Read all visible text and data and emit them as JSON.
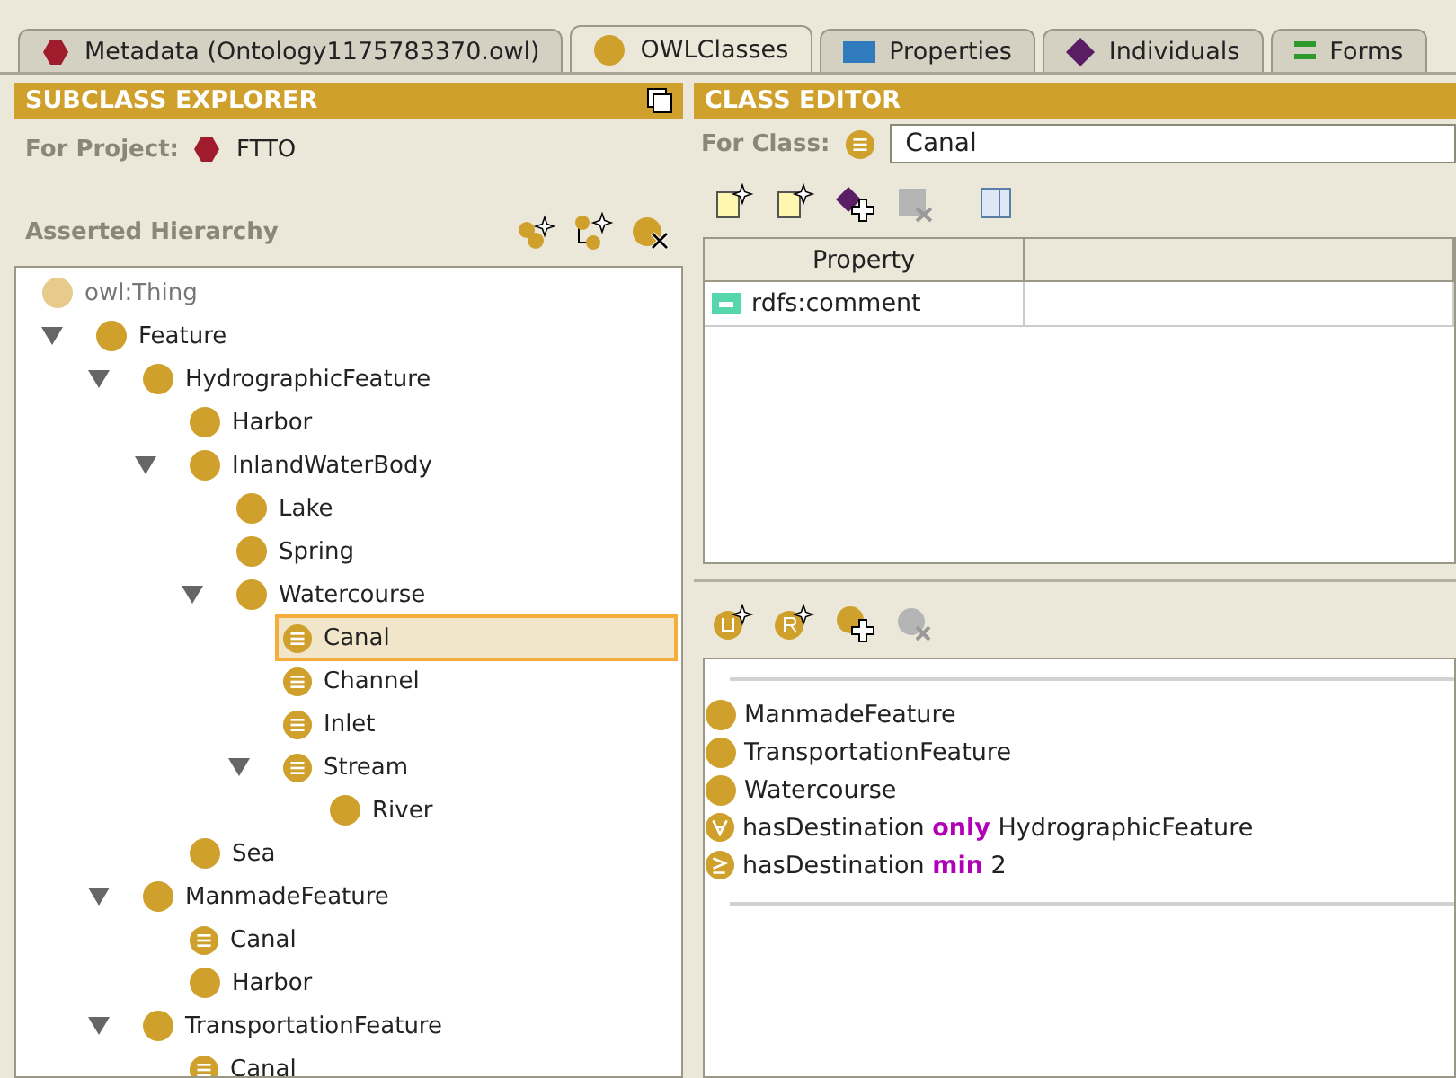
{
  "tabs": [
    {
      "label": "Metadata (Ontology1175783370.owl)",
      "kind": "metadata",
      "selected": false
    },
    {
      "label": "OWLClasses",
      "kind": "classes",
      "selected": true
    },
    {
      "label": "Properties",
      "kind": "properties",
      "selected": false
    },
    {
      "label": "Individuals",
      "kind": "individuals",
      "selected": false
    },
    {
      "label": "Forms",
      "kind": "forms",
      "selected": false
    }
  ],
  "subclass_explorer": {
    "title": "SUBCLASS EXPLORER",
    "project_label": "For Project:",
    "project_name": "FTTO",
    "hierarchy_label": "Asserted Hierarchy",
    "tree": [
      {
        "label": "owl:Thing",
        "kind": "root",
        "selected": false,
        "children": [
          {
            "label": "Feature",
            "kind": "primitive",
            "expanded": true,
            "selected": false,
            "children": [
              {
                "label": "HydrographicFeature",
                "kind": "primitive",
                "expanded": true,
                "selected": false,
                "children": [
                  {
                    "label": "Harbor",
                    "kind": "primitive",
                    "expanded": false,
                    "selected": false
                  },
                  {
                    "label": "InlandWaterBody",
                    "kind": "primitive",
                    "expanded": true,
                    "selected": false,
                    "children": [
                      {
                        "label": "Lake",
                        "kind": "primitive",
                        "expanded": false,
                        "selected": false
                      },
                      {
                        "label": "Spring",
                        "kind": "primitive",
                        "expanded": false,
                        "selected": false
                      },
                      {
                        "label": "Watercourse",
                        "kind": "primitive",
                        "expanded": true,
                        "selected": false,
                        "children": [
                          {
                            "label": "Canal",
                            "kind": "defined",
                            "expanded": false,
                            "selected": true
                          },
                          {
                            "label": "Channel",
                            "kind": "defined",
                            "expanded": false,
                            "selected": false
                          },
                          {
                            "label": "Inlet",
                            "kind": "defined",
                            "expanded": false,
                            "selected": false
                          },
                          {
                            "label": "Stream",
                            "kind": "defined",
                            "expanded": true,
                            "selected": false,
                            "children": [
                              {
                                "label": "River",
                                "kind": "primitive",
                                "expanded": false,
                                "selected": false
                              }
                            ]
                          }
                        ]
                      }
                    ]
                  },
                  {
                    "label": "Sea",
                    "kind": "primitive",
                    "expanded": false,
                    "selected": false
                  }
                ]
              },
              {
                "label": "ManmadeFeature",
                "kind": "primitive",
                "expanded": true,
                "selected": false,
                "children": [
                  {
                    "label": "Canal",
                    "kind": "defined",
                    "expanded": false,
                    "selected": false
                  },
                  {
                    "label": "Harbor",
                    "kind": "primitive",
                    "expanded": false,
                    "selected": false
                  }
                ]
              },
              {
                "label": "TransportationFeature",
                "kind": "primitive",
                "expanded": true,
                "selected": false,
                "children": [
                  {
                    "label": "Canal",
                    "kind": "defined",
                    "expanded": false,
                    "selected": false
                  }
                ]
              }
            ]
          }
        ]
      }
    ]
  },
  "class_editor": {
    "title": "CLASS EDITOR",
    "for_class_label": "For Class:",
    "for_class_value": "Canal",
    "table": {
      "columns": [
        "Property"
      ],
      "rows": [
        {
          "property": "rdfs:comment"
        }
      ]
    },
    "conditions": [
      {
        "kind": "class",
        "text": "ManmadeFeature"
      },
      {
        "kind": "class",
        "text": "TransportationFeature"
      },
      {
        "kind": "class",
        "text": "Watercourse"
      },
      {
        "kind": "all",
        "text": "hasDestination **only** HydrographicFeature"
      },
      {
        "kind": "min",
        "text": "hasDestination **min** 2"
      }
    ]
  }
}
